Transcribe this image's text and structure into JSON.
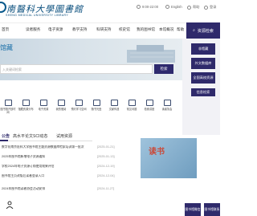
{
  "header": {
    "logo_title": "南醫科大學圖書館",
    "logo_subtitle": "SHENG MEDICAL UNIVERSITY LIBRARY",
    "phone": "9:00-22:00",
    "language": "English",
    "help": "帮助",
    "login": "登录"
  },
  "nav": {
    "items": [
      "首页",
      "读者服务",
      "电子资源",
      "教学支持",
      "科研支持",
      "校史馆",
      "我的图书馆",
      "本馆概况",
      "帮助"
    ],
    "active_label": "资源检索"
  },
  "hero": {
    "title": "馆藏",
    "search_placeholder": "入关键词检索",
    "search_button": "检索"
  },
  "sidebar": {
    "items": [
      "非馆藏",
      "外文数据库",
      "全国高校资源",
      "信息检索"
    ]
  },
  "quick_links": [
    {
      "label": "图书馆开放时间"
    },
    {
      "label": "馆藏资源分布"
    },
    {
      "label": "电子资源"
    },
    {
      "label": "我的借阅"
    },
    {
      "label": "预约学习空间"
    },
    {
      "label": "随书光盘"
    },
    {
      "label": "文献传递"
    },
    {
      "label": "常见问题"
    },
    {
      "label": "检索讲座"
    },
    {
      "label": "读者协会"
    }
  ],
  "news": {
    "tabs": [
      "公告",
      "高水平论文SCI动态",
      "试用资源"
    ],
    "items": [
      {
        "title": "数字化南京医科大学图书馆主题资源数据库检索培训第一批次",
        "date": "[2025-01-21]"
      },
      {
        "title": "2025年图书馆新增电子资源通知",
        "date": "[2025-01-13]"
      },
      {
        "title": "学校2024年电子资源订购使用效果评估",
        "date": "[2024-12-19]"
      },
      {
        "title": "图书馆主页改版后读者登录入口",
        "date": "[2024-12-04]"
      },
      {
        "title": "2024年图书馆读者协会活动安排",
        "date": "[2024-11-27]"
      }
    ],
    "promo_text": "读书"
  },
  "bottom": {
    "btn1": "图书馆微信",
    "btn2": "图书馆联系"
  },
  "colors": {
    "primary": "#2f2a6b",
    "logo": "#0a4f7e",
    "accent": "#1a6fa8"
  }
}
